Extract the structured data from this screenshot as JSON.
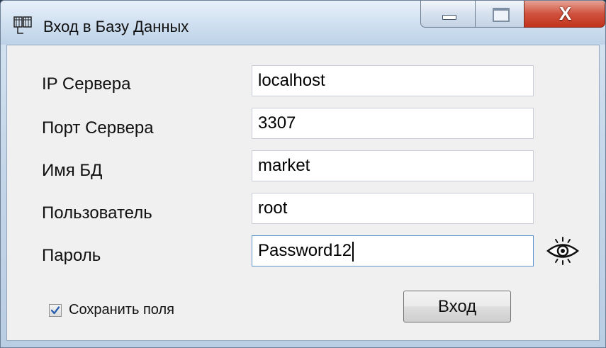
{
  "window": {
    "title": "Вход в Базу Данных",
    "close_glyph": "X"
  },
  "form": {
    "fields": [
      {
        "label": "IP Сервера",
        "value": "localhost"
      },
      {
        "label": "Порт Сервера",
        "value": "3307"
      },
      {
        "label": "Имя БД",
        "value": "market"
      },
      {
        "label": "Пользователь",
        "value": "root"
      },
      {
        "label": "Пароль",
        "value": "Password12"
      }
    ],
    "show_password_icon": "eye-icon",
    "save_fields": {
      "label": "Сохранить поля",
      "checked": true
    },
    "submit_label": "Вход"
  },
  "colors": {
    "close_button": "#c2331c",
    "active_field_border": "#5e95cf",
    "checkmark": "#2a5fb0"
  }
}
